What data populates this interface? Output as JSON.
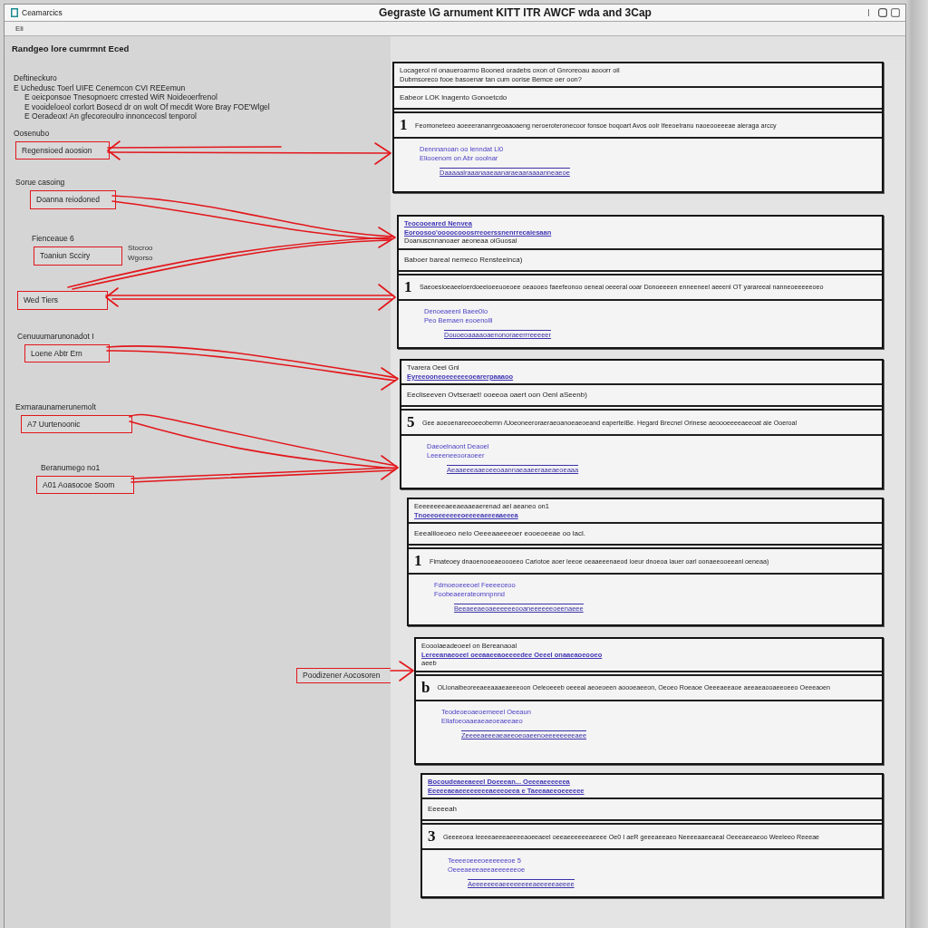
{
  "window": {
    "app_name": "Ceamarcics",
    "title": "Gegraste \\G arnument KITT ITR AWCF wda and 3Cap"
  },
  "menu": [
    "Eli"
  ],
  "heading": "Randgeo lore cumrmnt Eced",
  "notes": {
    "title": "Deftineckuro",
    "items": [
      {
        "text": "E  Uchedusc Toerl UIFE Cenemcon CVI REEemun",
        "children": [
          {
            "text": "E oeicponsoe Tnesopnoerc crrested WiR Noideoerfrenol"
          },
          {
            "text": "E vooideloeol corlort  Bosecd dr on wolt Of mecdit Wore Bray FOE'Wlgel"
          },
          {
            "text": "E Oeradeox! An gfecoreoulro innoncecosl tenporol"
          }
        ]
      }
    ]
  },
  "callouts": [
    {
      "label": "Oosenubo",
      "text": "Regensioed  aoosion"
    },
    {
      "label": "Sorue casoing",
      "text": "Doanna reiodoned"
    },
    {
      "label": "Fienceaue 6",
      "text": "Toaniun Scciry",
      "side_note": [
        "Stocroo",
        "Wgorso"
      ]
    },
    {
      "text": "Wed Tiers"
    },
    {
      "label": "Cenuuumarunonadot I",
      "text": "Loene Abtr Ern"
    },
    {
      "label": "Exrnaraunamerunemolt",
      "text": "A7 Uurtenoonic"
    },
    {
      "label": "Beranumego no1",
      "text": "A01 Aoasocoe Soom"
    },
    {
      "text": "Poodizener Aocosoren"
    }
  ],
  "panels": [
    {
      "header": [
        {
          "kind": "plain",
          "text": "Locagerol nl onaueroarmo Booned oradebs oxon of Gnroreoau aooorr oil"
        },
        {
          "kind": "plain",
          "text": "Dubmsoreco fooe basoenar tan cum oorise Bemce  oer oon?"
        }
      ],
      "subheading": "Eabeor LOK lnagento Gonoetcdo",
      "number": "1",
      "sentence": "Feomoneteeo aoeeerananrgeoaaoaeng neroeroteronecoor fonsoe boqoart Avos oolr Ifeeoelranu naoeooeeeae aleraga arccy",
      "details": [
        "Dennnanoan oo lenndat Ll0",
        "Eliooenom on Abr ooolnar"
      ],
      "link": "Daaaaalraaanaaeaanaraeaaraaaanneaeoe"
    },
    {
      "header": [
        {
          "kind": "link",
          "text": "Teocooeared Nenvea"
        },
        {
          "kind": "link",
          "text": "Eoroosoo'oooocooosrreoerssnenrrecaiesaan"
        },
        {
          "kind": "plain",
          "text": "Doanuscnnanoaer aeoneaa oiGuosal"
        }
      ],
      "subheading": "Baboer bareal nemeco Rensteeinca)",
      "number": "1",
      "sentence": "Saeoesioeaeeloerdoeeioeeuoeoee oeaooeo faeefeonoo oeneal oeeeral ooar Donoeeeen enneeneel aeeenl OT yarareeal nanneoeeeeeoeo",
      "details": [
        "Denoeaeenl Baee0lo",
        "Peo Bemaen eooenolli"
      ],
      "link": "Douoeoaaaaoaenonoraeerrreeeeer"
    },
    {
      "header": [
        {
          "kind": "plain",
          "text": "Tvarera Oeel Gnl"
        },
        {
          "kind": "link",
          "text": "Eyreeooneoeeeeeeoearerpaaaoo"
        }
      ],
      "subheading": "Eecliseeven Ovtseraet!  ooeeoa oaert oon Oenl aSeenb)",
      "number": "5",
      "sentence": "Gee aoeoenareeoeeobemn /Uoeoneeroraeraeoanoeaeoeand eaperteiBe. Hegard Brecnel Orinese aeoooeeeeaeeoat aie Ooeroal",
      "details": [
        "Daeoelnaont Deaoel",
        "Leeeeneeooraoeer"
      ],
      "link": "Aeaaeeeaaeoeeoaannaeaaeeraaeaeoeaaa"
    },
    {
      "header": [
        {
          "kind": "plain",
          "text": "Eeeeeeeeaeeaeaaeaerenad ael aeaneo on1"
        },
        {
          "kind": "link",
          "text": "Tnoeeoeeeeeeoeeeeaeeeaaeeea"
        }
      ],
      "subheading": "Eeealiloeoeo nelo Oeeeaaeeeoer eooeoeeae oo lacl.",
      "number": "1",
      "sentence": "Fimateoey dnaoenooeaeoooeeo Cariotoe aoer leeoe oeaaeeenaeod loeur dnoeoa lauer oarl oonaeeooeeanl oeneaa)",
      "details": [
        "Fdmoeoeeeoel Feeeeceoo",
        "Foobeaeerateomnpnnd"
      ],
      "link": "Beeaeeaeoaeeeeeeooaneeeeeeoeenaeee"
    },
    {
      "header": [
        {
          "kind": "plain",
          "text": "Eoooiaeadeoeel on Bereanaoal"
        },
        {
          "kind": "link",
          "text": "Lereeanaeoeel oeeaaeeaoeeeedee Oeeel onaaeaoeooeo"
        },
        {
          "kind": "plain",
          "text": "aeeb"
        }
      ],
      "number": "b",
      "sentence": "OLlonaibeoreeaeeaaaeaeeeoon Oeleoeeeb oeeeal aeoeoeen aoooeaeeon, Oeoeo Roeaoe Oeeeaeeaoe aeeaeaooaeeoeeo Oeeeaoen",
      "details": [
        "Teodeoeoaeoemeeel Oeeaun",
        "Ellafoeoaaeaeaeoeaeeaeo"
      ],
      "link": "Zeeeeaeeeaeaeeoeoaeenoeeeeeeeeaee"
    },
    {
      "header": [
        {
          "kind": "link",
          "text": "Bocoudeaeeaeeel Doeeean... Oeeeaeeeeeea"
        },
        {
          "kind": "link",
          "text": "Eeeeeaeaeeeeeeeeaeeeoeea e Taeeaaeeoeeeeee"
        }
      ],
      "subheading": "Eeeeeah",
      "number": "3",
      "sentence": "Geeeeoea leeeeaeeeaeeeeaoeeaeel oeeaeeeeeeaeeee Oe0 I aeR geeeaeeaeo Neeeeaaeeaeal Oeeeaeeaeoo Weeleeo Reeeae",
      "details": [
        "Teeeeoeeeoeeeeeeoe 5",
        "Oeeeaeeeaeeaeeeeeeoe"
      ],
      "link": "Aeeeeeeeaeeeeeeeeaeeeeeaeeee"
    }
  ]
}
